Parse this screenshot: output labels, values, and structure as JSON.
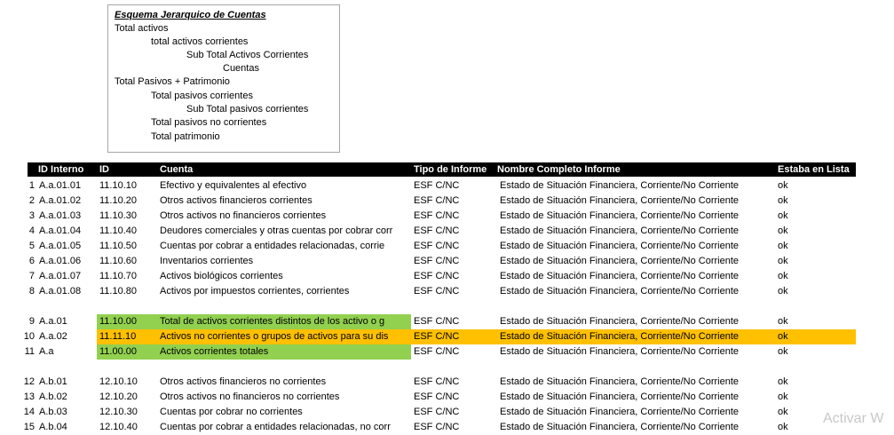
{
  "tree": {
    "title": "Esquema Jerarquico de Cuentas",
    "lines": [
      "Total activos",
      "total activos corrientes",
      "Sub Total Activos Corrientes",
      "Cuentas",
      "Total Pasivos + Patrimonio",
      "Total pasivos corrientes",
      "Sub Total pasivos corrientes",
      "Total pasivos no corrientes",
      "Total patrimonio"
    ]
  },
  "table": {
    "headers": {
      "id_interno": "ID Interno",
      "id": "ID",
      "cuenta": "Cuenta",
      "tipo": "Tipo de Informe",
      "nombre": "Nombre Completo Informe",
      "lista": "Estaba en Lista"
    },
    "rows": [
      {
        "num": "1",
        "id_interno": "A.a.01.01",
        "id": "11.10.10",
        "cuenta": "Efectivo y equivalentes al efectivo",
        "tipo": "ESF C/NC",
        "nombre": "Estado de Situación Financiera, Corriente/No Corriente",
        "lista": "ok"
      },
      {
        "num": "2",
        "id_interno": "A.a.01.02",
        "id": "11.10.20",
        "cuenta": "Otros activos financieros corrientes",
        "tipo": "ESF C/NC",
        "nombre": "Estado de Situación Financiera, Corriente/No Corriente",
        "lista": "ok"
      },
      {
        "num": "3",
        "id_interno": "A.a.01.03",
        "id": "11.10.30",
        "cuenta": "Otros activos no financieros corrientes",
        "tipo": "ESF C/NC",
        "nombre": "Estado de Situación Financiera, Corriente/No Corriente",
        "lista": "ok"
      },
      {
        "num": "4",
        "id_interno": "A.a.01.04",
        "id": "11.10.40",
        "cuenta": "Deudores comerciales y otras cuentas por cobrar corr",
        "tipo": "ESF C/NC",
        "nombre": "Estado de Situación Financiera, Corriente/No Corriente",
        "lista": "ok"
      },
      {
        "num": "5",
        "id_interno": "A.a.01.05",
        "id": "11.10.50",
        "cuenta": "Cuentas por cobrar a entidades relacionadas, corrie",
        "tipo": "ESF C/NC",
        "nombre": "Estado de Situación Financiera, Corriente/No Corriente",
        "lista": "ok"
      },
      {
        "num": "6",
        "id_interno": "A.a.01.06",
        "id": "11.10.60",
        "cuenta": "Inventarios corrientes",
        "tipo": "ESF C/NC",
        "nombre": "Estado de Situación Financiera, Corriente/No Corriente",
        "lista": "ok"
      },
      {
        "num": "7",
        "id_interno": "A.a.01.07",
        "id": "11.10.70",
        "cuenta": "Activos biológicos corrientes",
        "tipo": "ESF C/NC",
        "nombre": "Estado de Situación Financiera, Corriente/No Corriente",
        "lista": "ok"
      },
      {
        "num": "8",
        "id_interno": "A.a.01.08",
        "id": "11.10.80",
        "cuenta": "Activos por impuestos corrientes, corrientes",
        "tipo": "ESF C/NC",
        "nombre": "Estado de Situación Financiera, Corriente/No Corriente",
        "lista": "ok"
      },
      {
        "num": "",
        "id_interno": "",
        "id": "",
        "cuenta": "",
        "tipo": "",
        "nombre": "",
        "lista": ""
      },
      {
        "num": "9",
        "id_interno": "A.a.01",
        "id": "11.10.00",
        "cuenta": "Total de activos corrientes distintos de los activo o g",
        "tipo": "ESF C/NC",
        "nombre": "Estado de Situación Financiera, Corriente/No Corriente",
        "lista": "ok",
        "hl": "green"
      },
      {
        "num": "10",
        "id_interno": "A.a.02",
        "id": "11.11.10",
        "cuenta": "Activos no corrientes o grupos de activos para su dis",
        "tipo": "ESF C/NC",
        "nombre": "Estado de Situación Financiera, Corriente/No Corriente",
        "lista": "ok",
        "hl": "orange"
      },
      {
        "num": "11",
        "id_interno": "A.a",
        "id": "11.00.00",
        "cuenta": "Activos corrientes totales",
        "tipo": "ESF C/NC",
        "nombre": "Estado de Situación Financiera, Corriente/No Corriente",
        "lista": "ok",
        "hl": "green"
      },
      {
        "num": "",
        "id_interno": "",
        "id": "",
        "cuenta": "",
        "tipo": "",
        "nombre": "",
        "lista": ""
      },
      {
        "num": "12",
        "id_interno": "A.b.01",
        "id": "12.10.10",
        "cuenta": "Otros activos financieros no corrientes",
        "tipo": "ESF C/NC",
        "nombre": "Estado de Situación Financiera, Corriente/No Corriente",
        "lista": "ok"
      },
      {
        "num": "13",
        "id_interno": "A.b.02",
        "id": "12.10.20",
        "cuenta": "Otros activos no financieros no corrientes",
        "tipo": "ESF C/NC",
        "nombre": "Estado de Situación Financiera, Corriente/No Corriente",
        "lista": "ok"
      },
      {
        "num": "14",
        "id_interno": "A.b.03",
        "id": "12.10.30",
        "cuenta": "Cuentas por cobrar no corrientes",
        "tipo": "ESF C/NC",
        "nombre": "Estado de Situación Financiera, Corriente/No Corriente",
        "lista": "ok"
      },
      {
        "num": "15",
        "id_interno": "A.b.04",
        "id": "12.10.40",
        "cuenta": "Cuentas por cobrar a entidades relacionadas, no corr",
        "tipo": "ESF C/NC",
        "nombre": "Estado de Situación Financiera, Corriente/No Corriente",
        "lista": "ok"
      }
    ]
  },
  "colors": {
    "green": "#92d050",
    "orange": "#ffc000",
    "header_bg": "#000000",
    "header_text": "#ffffff"
  },
  "watermark": "Activar W"
}
